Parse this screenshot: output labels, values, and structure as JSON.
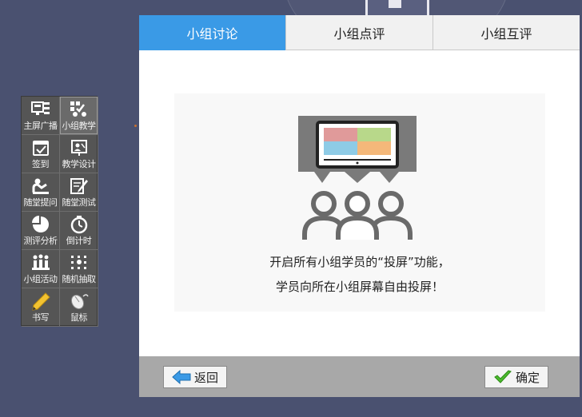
{
  "toolbar": {
    "items": [
      {
        "label": "主屏广播",
        "icon": "screen-broadcast-icon"
      },
      {
        "label": "小组教学",
        "icon": "group-teaching-icon",
        "active": true
      },
      {
        "label": "签到",
        "icon": "checkin-icon"
      },
      {
        "label": "教学设计",
        "icon": "teaching-design-icon"
      },
      {
        "label": "随堂提问",
        "icon": "question-icon"
      },
      {
        "label": "随堂测试",
        "icon": "quiz-icon"
      },
      {
        "label": "测评分析",
        "icon": "pie-chart-icon"
      },
      {
        "label": "倒计时",
        "icon": "timer-icon"
      },
      {
        "label": "小组活动",
        "icon": "group-activity-icon"
      },
      {
        "label": "随机抽取",
        "icon": "random-pick-icon"
      },
      {
        "label": "书写",
        "icon": "pencil-icon"
      },
      {
        "label": "鼠标",
        "icon": "mouse-icon"
      }
    ]
  },
  "dialog": {
    "tabs": [
      {
        "label": "小组讨论",
        "active": true
      },
      {
        "label": "小组点评"
      },
      {
        "label": "小组互评"
      }
    ],
    "message_line1": "开启所有小组学员的“投屏”功能，",
    "message_line2": "学员向所在小组屏幕自由投屏！",
    "back_label": "返回",
    "ok_label": "确定"
  },
  "colors": {
    "background": "#4a5170",
    "tab_active": "#3a9ae6",
    "footer": "#a8a8a8"
  }
}
